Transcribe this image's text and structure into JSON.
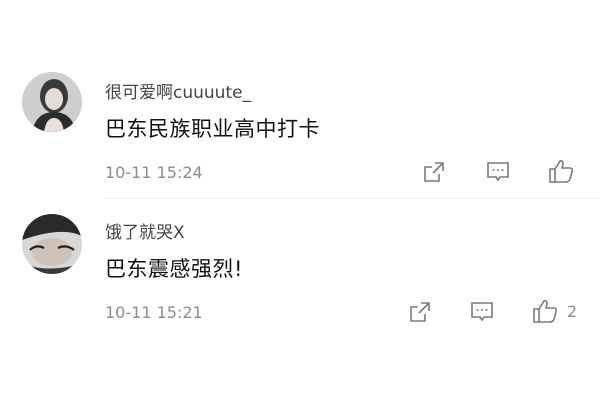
{
  "comments": [
    {
      "username": "很可爱啊cuuuute_",
      "content": "巴东民族职业高中打卡",
      "time": "10-11 15:24",
      "like_count": ""
    },
    {
      "username": "饿了就哭X",
      "content": "巴东震感强烈!",
      "time": "10-11 15:21",
      "like_count": "2"
    }
  ],
  "icons": {
    "share": "share-icon",
    "comment": "comment-icon",
    "like": "thumbs-up-icon"
  },
  "colors": {
    "meta_text": "#8c8c8c",
    "icon_stroke": "#7a7a7a"
  }
}
